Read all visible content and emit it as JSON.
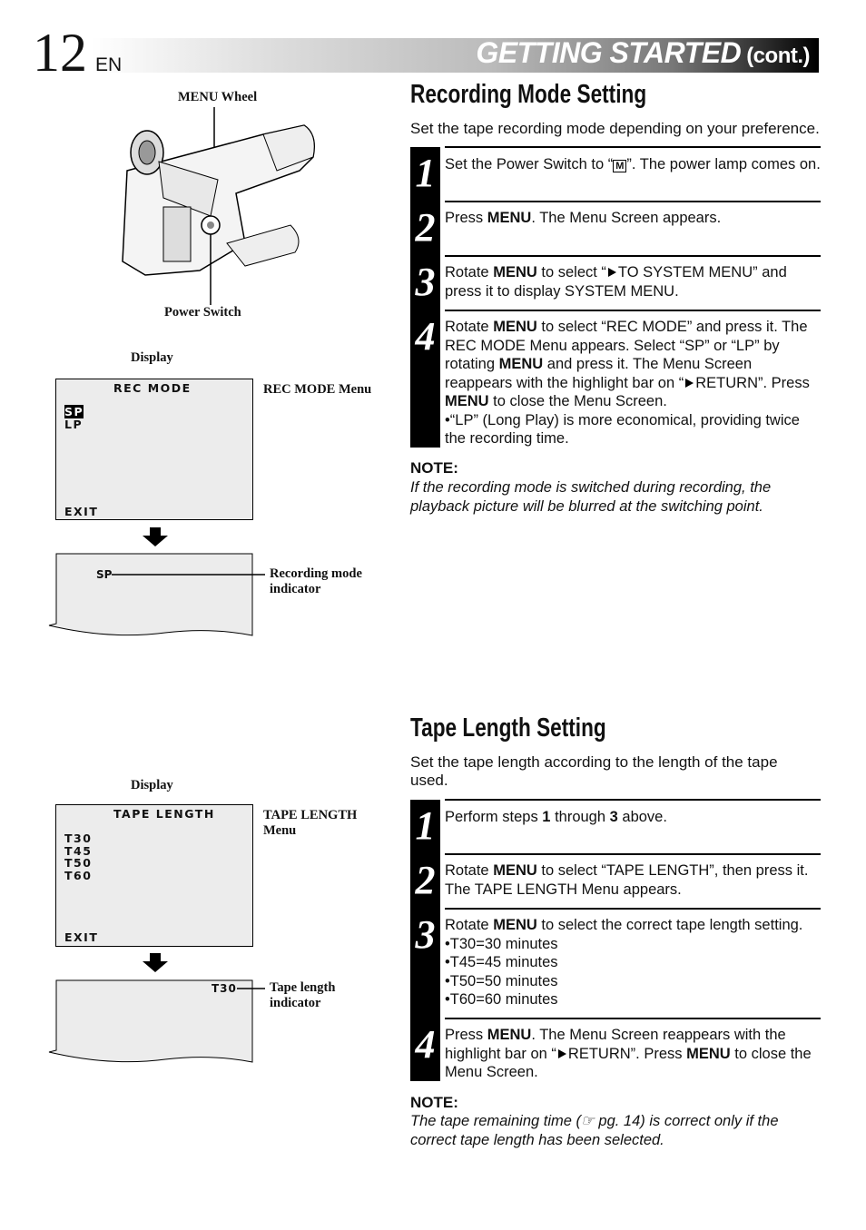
{
  "header": {
    "page_number": "12",
    "lang": "EN",
    "section_title": "GETTING STARTED",
    "section_suffix": "(cont.)"
  },
  "figure_top": {
    "menu_wheel_label": "MENU Wheel",
    "power_switch_label": "Power Switch",
    "display_label": "Display",
    "menu_title": "REC MODE",
    "options": [
      "SP",
      "LP"
    ],
    "exit": "EXIT",
    "menu_caption": "REC MODE Menu",
    "indicator": "SP",
    "indicator_caption_1": "Recording mode",
    "indicator_caption_2": "indicator"
  },
  "recording": {
    "title": "Recording Mode Setting",
    "intro": "Set the tape recording mode depending on your preference.",
    "steps": [
      {
        "n": "1",
        "a": "Set the Power Switch to “",
        "icon": "M",
        "b": "”. The power lamp comes on."
      },
      {
        "n": "2",
        "a": "Press ",
        "k": "MENU",
        "b": ". The Menu Screen appears."
      },
      {
        "n": "3",
        "a": "Rotate ",
        "k": "MENU",
        "b": " to select “",
        "c": "TO SYSTEM MENU” and press it to display SYSTEM MENU."
      },
      {
        "n": "4",
        "a": "Rotate ",
        "k": "MENU",
        "b": " to select “REC MODE” and press it. The REC MODE Menu appears. Select “SP” or “LP” by rotating ",
        "k2": "MENU",
        "c": " and press it. The Menu Screen reappears with the highlight bar on “",
        "d": "RETURN”. Press ",
        "k3": "MENU",
        "e": " to close the Menu Screen.",
        "bullet": "•“LP” (Long Play) is more economical, providing twice the recording time."
      }
    ],
    "note_label": "NOTE:",
    "note": "If the recording mode is switched during recording, the playback picture will be blurred at the switching point."
  },
  "figure_bottom": {
    "display_label": "Display",
    "menu_title": "TAPE LENGTH",
    "options": [
      "T30",
      "T45",
      "T50",
      "T60"
    ],
    "exit": "EXIT",
    "menu_caption_1": "TAPE LENGTH",
    "menu_caption_2": "Menu",
    "indicator": "T30",
    "indicator_caption_1": "Tape length",
    "indicator_caption_2": "indicator"
  },
  "tape": {
    "title": "Tape Length Setting",
    "intro": "Set the tape length according to the length of the tape used.",
    "steps": [
      {
        "n": "1",
        "a": "Perform steps ",
        "k": "1",
        "b": " through ",
        "k2": "3",
        "c": " above."
      },
      {
        "n": "2",
        "a": "Rotate ",
        "k": "MENU",
        "b": " to select “TAPE LENGTH”, then press it. The TAPE LENGTH Menu appears."
      },
      {
        "n": "3",
        "a": "Rotate ",
        "k": "MENU",
        "b": " to select the correct tape length setting.",
        "bullets": [
          "•T30=30 minutes",
          "•T45=45 minutes",
          "•T50=50 minutes",
          "•T60=60 minutes"
        ]
      },
      {
        "n": "4",
        "a": "Press ",
        "k": "MENU",
        "b": ". The Menu Screen reappears with the highlight bar on “",
        "c": "RETURN”. Press ",
        "k2": "MENU",
        "d": " to close the Menu Screen."
      }
    ],
    "note_label": "NOTE:",
    "note_a": "The tape remaining time (",
    "note_ref": "☞ pg. 14",
    "note_b": ") is correct only if the correct tape length has been selected."
  }
}
